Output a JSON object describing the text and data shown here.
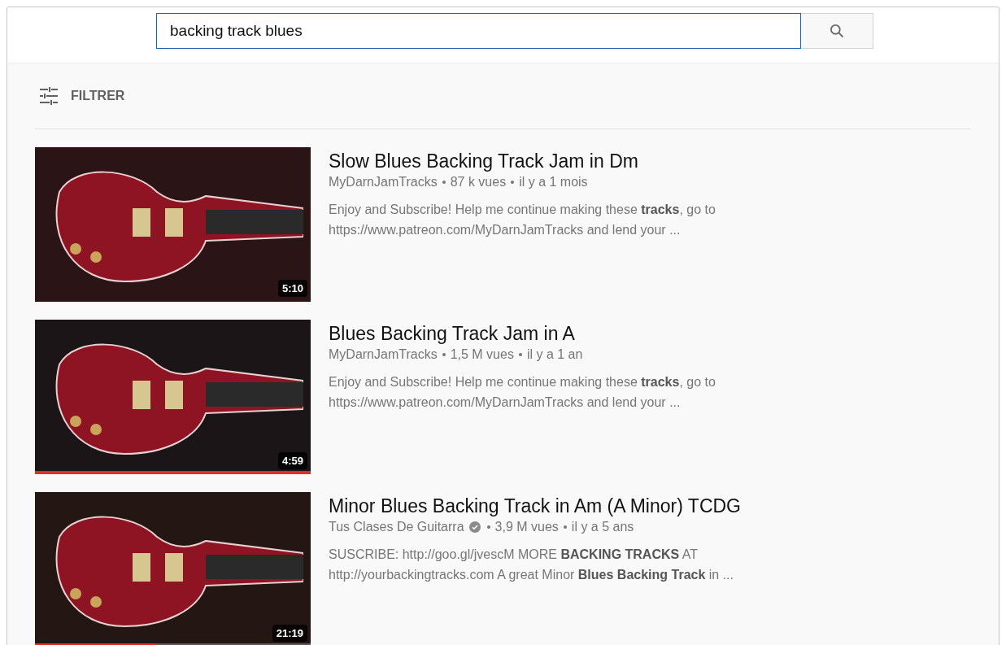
{
  "search": {
    "value": "backing track blues"
  },
  "filter": {
    "label": "FILTRER"
  },
  "results": [
    {
      "title": "Slow Blues Backing Track Jam in Dm",
      "channel": "MyDarnJamTracks",
      "verified": false,
      "views": "87 k vues",
      "age": "il y a 1 mois",
      "description": "Enjoy and Subscribe! Help me continue making these **tracks**, go to https://www.patreon.com/MyDarnJamTracks and lend your ...",
      "duration": "5:10"
    },
    {
      "title": "Blues Backing Track Jam in A",
      "channel": "MyDarnJamTracks",
      "verified": false,
      "views": "1,5 M vues",
      "age": "il y a 1 an",
      "description": "Enjoy and Subscribe! Help me continue making these **tracks**, go to https://www.patreon.com/MyDarnJamTracks and lend your ...",
      "duration": "4:59",
      "level": 1
    },
    {
      "title": "Minor Blues Backing Track in Am (A Minor) TCDG",
      "channel": "Tus Clases De Guitarra",
      "verified": true,
      "views": "3,9 M vues",
      "age": "il y a 5 ans",
      "description": "SUSCRIBE: http://goo.gl/jvescM MORE **BACKING TRACKS** AT http://yourbackingtracks.com A great Minor **Blues Backing Track** in ...",
      "duration": "21:19",
      "level": 0.44
    }
  ]
}
